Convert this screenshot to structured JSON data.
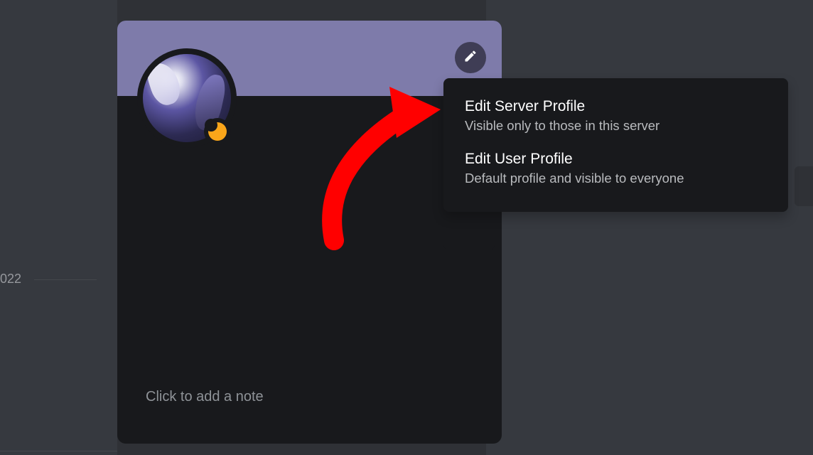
{
  "background": {
    "year_partial": "022"
  },
  "profile": {
    "banner_color": "#7e7baa",
    "note_placeholder": "Click to add a note",
    "status": "idle"
  },
  "popup": {
    "items": [
      {
        "title": "Edit Server Profile",
        "subtitle": "Visible only to those in this server"
      },
      {
        "title": "Edit User Profile",
        "subtitle": "Default profile and visible to everyone"
      }
    ]
  }
}
